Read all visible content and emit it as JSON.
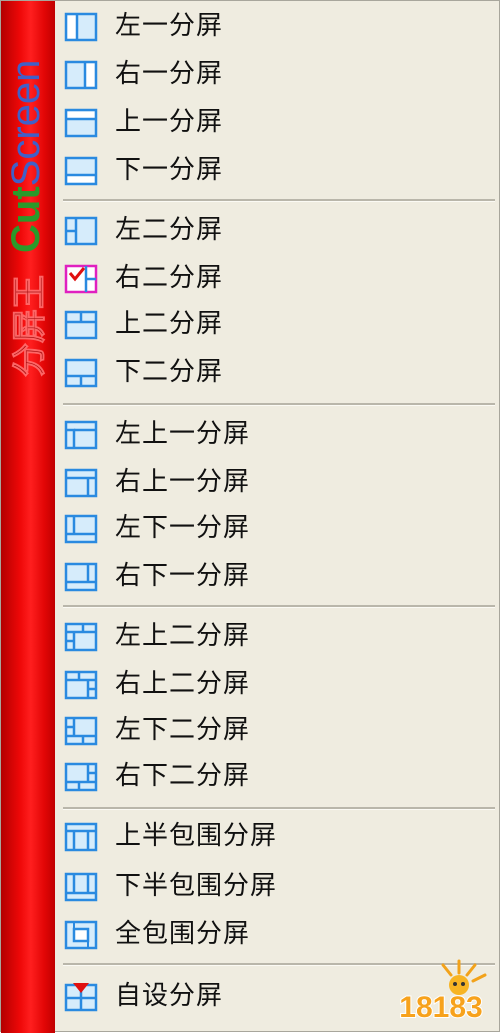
{
  "brand": {
    "text_a": "Cut",
    "text_b": "Screen",
    "chinese": "分屏王"
  },
  "groups": [
    {
      "items": [
        {
          "id": "left-1",
          "label": "左一分屏",
          "icon": "split-left-one-icon"
        },
        {
          "id": "right-1",
          "label": "右一分屏",
          "icon": "split-right-one-icon"
        },
        {
          "id": "top-1",
          "label": "上一分屏",
          "icon": "split-top-one-icon"
        },
        {
          "id": "bottom-1",
          "label": "下一分屏",
          "icon": "split-bottom-one-icon"
        }
      ]
    },
    {
      "items": [
        {
          "id": "left-2",
          "label": "左二分屏",
          "icon": "split-left-two-icon"
        },
        {
          "id": "right-2",
          "label": "右二分屏",
          "icon": "split-right-two-icon"
        },
        {
          "id": "top-2",
          "label": "上二分屏",
          "icon": "split-top-two-icon"
        },
        {
          "id": "bottom-2",
          "label": "下二分屏",
          "icon": "split-bottom-two-icon"
        }
      ]
    },
    {
      "items": [
        {
          "id": "top-left-1",
          "label": "左上一分屏",
          "icon": "split-top-left-one-icon"
        },
        {
          "id": "top-right-1",
          "label": "右上一分屏",
          "icon": "split-top-right-one-icon"
        },
        {
          "id": "bottom-left-1",
          "label": "左下一分屏",
          "icon": "split-bottom-left-one-icon"
        },
        {
          "id": "bottom-right-1",
          "label": "右下一分屏",
          "icon": "split-bottom-right-one-icon"
        }
      ]
    },
    {
      "items": [
        {
          "id": "top-left-2",
          "label": "左上二分屏",
          "icon": "split-top-left-two-icon"
        },
        {
          "id": "top-right-2",
          "label": "右上二分屏",
          "icon": "split-top-right-two-icon"
        },
        {
          "id": "bottom-left-2",
          "label": "左下二分屏",
          "icon": "split-bottom-left-two-icon"
        },
        {
          "id": "bottom-right-2",
          "label": "右下二分屏",
          "icon": "split-bottom-right-two-icon"
        }
      ]
    },
    {
      "items": [
        {
          "id": "top-half-wrap",
          "label": "上半包围分屏",
          "icon": "split-top-half-wrap-icon"
        },
        {
          "id": "bottom-half-wrap",
          "label": "下半包围分屏",
          "icon": "split-bottom-half-wrap-icon"
        },
        {
          "id": "full-wrap",
          "label": "全包围分屏",
          "icon": "split-full-wrap-icon"
        }
      ]
    },
    {
      "items": [
        {
          "id": "custom",
          "label": "自设分屏",
          "icon": "split-custom-icon"
        }
      ]
    }
  ],
  "watermark": {
    "text": "18183"
  },
  "colors": {
    "sidebar_red": "#ee0808",
    "brand_green": "#2a9a2a",
    "brand_blue": "#4060c8",
    "menu_bg": "#efece0",
    "icon_blue": "#2a8ae0",
    "check_magenta": "#e020c0"
  }
}
